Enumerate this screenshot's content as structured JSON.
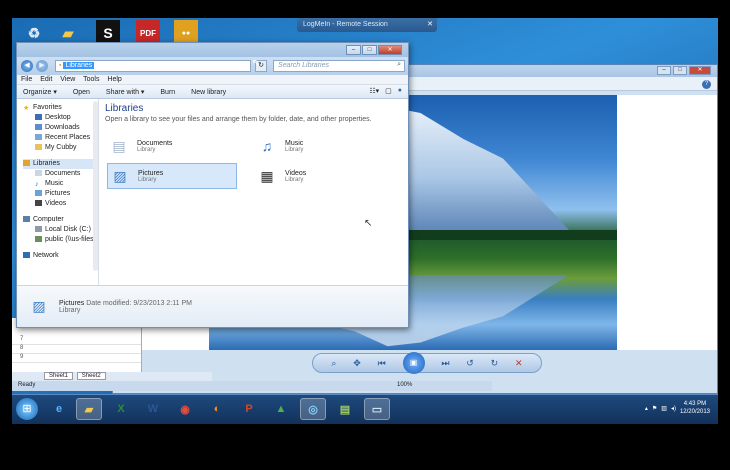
{
  "logmein_title": "LogMeIn - Remote Session",
  "explorer": {
    "address": "Libraries",
    "search_placeholder": "Search Libraries",
    "menu": [
      "File",
      "Edit",
      "View",
      "Tools",
      "Help"
    ],
    "toolbar": [
      "Organize ▾",
      "Open",
      "Share with ▾",
      "Burn",
      "New library"
    ],
    "nav": {
      "favorites": "Favorites",
      "fav_items": [
        "Desktop",
        "Downloads",
        "Recent Places",
        "My Cubby"
      ],
      "libraries": "Libraries",
      "lib_items": [
        "Documents",
        "Music",
        "Pictures",
        "Videos"
      ],
      "computer": "Computer",
      "comp_items": [
        "Local Disk (C:)",
        "public (\\\\us-files"
      ],
      "network": "Network"
    },
    "main_title": "Libraries",
    "main_desc": "Open a library to see your files and arrange them by folder, date, and other properties.",
    "libs": [
      {
        "name": "Documents",
        "type": "Library"
      },
      {
        "name": "Music",
        "type": "Library"
      },
      {
        "name": "Pictures",
        "type": "Library"
      },
      {
        "name": "Videos",
        "type": "Library"
      }
    ],
    "details": {
      "name": "Pictures",
      "meta": "Date modified: 9/23/2013 2:11 PM",
      "type": "Library"
    }
  },
  "excel": {
    "rows": [
      "7",
      "8",
      "9"
    ],
    "sheets": [
      "Sheet1",
      "Sheet2"
    ],
    "status": "Ready",
    "zoom": "100%"
  },
  "clock": {
    "time": "4:43 PM",
    "date": "12/20/2013"
  },
  "colors": {
    "accent": "#1c5fb8",
    "taskbar": "#12315a"
  }
}
